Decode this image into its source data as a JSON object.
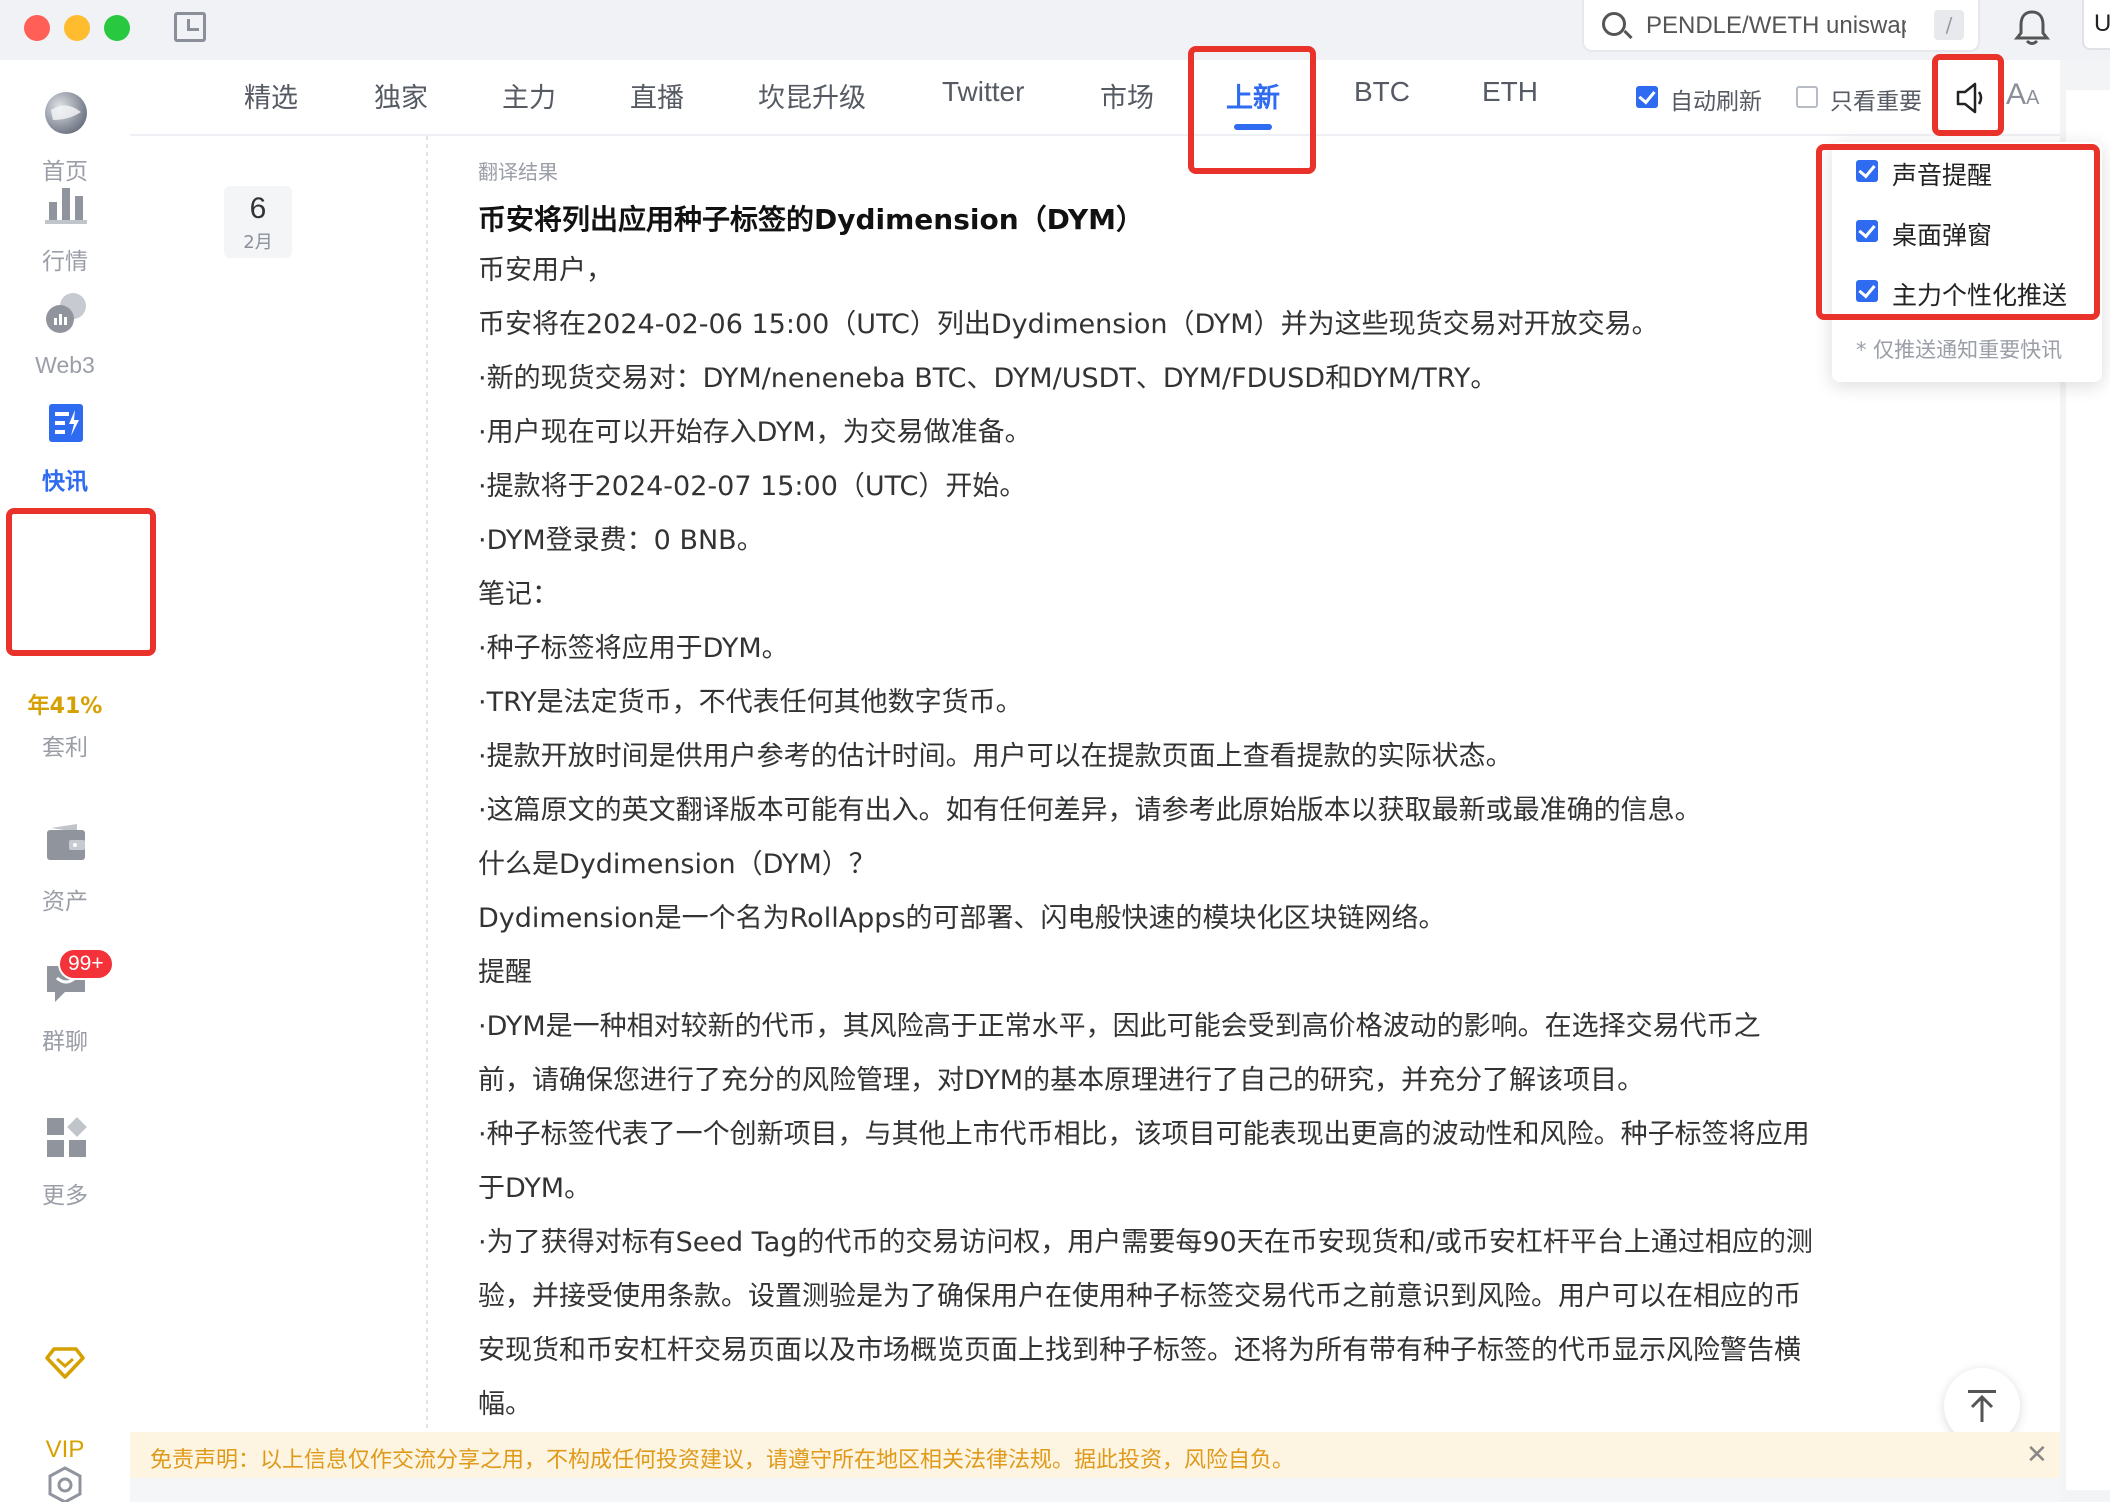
{
  "search": {
    "placeholder": "PENDLE/WETH uniswapv",
    "shortcut": "/"
  },
  "user_chip": "U",
  "sidebar": {
    "items": [
      {
        "label": "首页",
        "icon": "home-globe-icon"
      },
      {
        "label": "行情",
        "icon": "market-bars-icon"
      },
      {
        "label": "Web3",
        "icon": "web3-icon"
      },
      {
        "label": "快讯",
        "icon": "news-flash-icon",
        "active": true
      },
      {
        "label": "资产",
        "icon": "wallet-icon"
      },
      {
        "label": "群聊",
        "icon": "chat-icon"
      },
      {
        "label": "更多",
        "icon": "more-grid-icon"
      }
    ],
    "arbitrage_rate": "年41%",
    "arbitrage_label": "套利",
    "chat_badge": "99+",
    "vip_label": "VIP"
  },
  "tabs": [
    {
      "label": "精选"
    },
    {
      "label": "独家"
    },
    {
      "label": "主力"
    },
    {
      "label": "直播"
    },
    {
      "label": "坎昆升级"
    },
    {
      "label": "Twitter"
    },
    {
      "label": "市场"
    },
    {
      "label": "上新",
      "active": true
    },
    {
      "label": "BTC"
    },
    {
      "label": "ETH"
    }
  ],
  "options": {
    "auto_refresh": "自动刷新",
    "auto_refresh_checked": true,
    "important_only": "只看重要",
    "important_only_checked": false
  },
  "notify_dropdown": {
    "items": [
      {
        "label": "声音提醒",
        "checked": true
      },
      {
        "label": "桌面弹窗",
        "checked": true
      },
      {
        "label": "主力个性化推送",
        "checked": true
      }
    ],
    "note": "* 仅推送通知重要快讯"
  },
  "date": {
    "day": "6",
    "month": "2月"
  },
  "article": {
    "label": "翻译结果",
    "title": "币安将列出应用种子标签的Dydimension（DYM）",
    "lines": [
      "币安用户，",
      "币安将在2024-02-06 15:00（UTC）列出Dydimension（DYM）并为这些现货交易对开放交易。",
      "·新的现货交易对：DYM/neneneba BTC、DYM/USDT、DYM/FDUSD和DYM/TRY。",
      "·用户现在可以开始存入DYM，为交易做准备。",
      "·提款将于2024-02-07 15:00（UTC）开始。",
      "·DYM登录费：0 BNB。",
      "笔记：",
      "·种子标签将应用于DYM。",
      "·TRY是法定货币，不代表任何其他数字货币。",
      "·提款开放时间是供用户参考的估计时间。用户可以在提款页面上查看提款的实际状态。",
      "·这篇原文的英文翻译版本可能有出入。如有任何差异，请参考此原始版本以获取最新或最准确的信息。",
      "什么是Dydimension（DYM）？",
      "Dydimension是一个名为RollApps的可部署、闪电般快速的模块化区块链网络。",
      "提醒",
      "·DYM是一种相对较新的代币，其风险高于正常水平，因此可能会受到高价格波动的影响。在选择交易代币之",
      "前，请确保您进行了充分的风险管理，对DYM的基本原理进行了自己的研究，并充分了解该项目。",
      "·种子标签代表了一个创新项目，与其他上市代币相比，该项目可能表现出更高的波动性和风险。种子标签将应用",
      "于DYM。",
      "·为了获得对标有Seed Tag的代币的交易访问权，用户需要每90天在币安现货和/或币安杠杆平台上通过相应的测",
      "验，并接受使用条款。设置测验是为了确保用户在使用种子标签交易代币之前意识到风险。用户可以在相应的币",
      "安现货和币安杠杆交易页面以及市场概览页面上找到种子标签。还将为所有带有种子标签的代币显示风险警告横",
      "幅。"
    ]
  },
  "disclaimer": "免责声明：以上信息仅作交流分享之用，不构成任何投资建议，请遵守所在地区相关法律法规。据此投资，风险自负。",
  "colors": {
    "accent": "#2f6bf0",
    "highlight": "#e8322a",
    "vip": "#d6a100",
    "badge": "#f3323a"
  }
}
